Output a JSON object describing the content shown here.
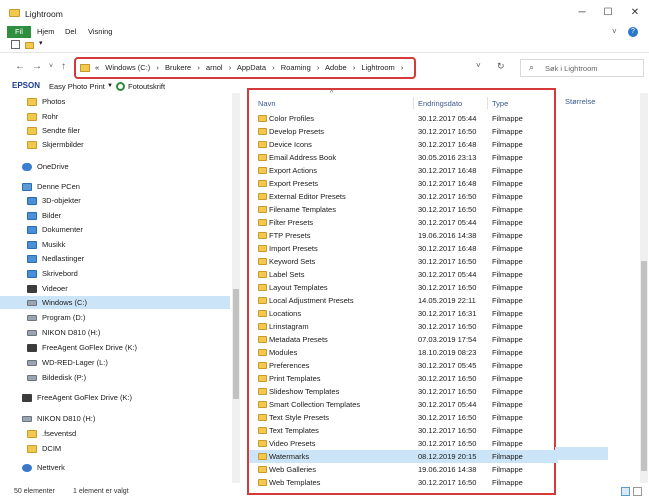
{
  "window": {
    "title": "Lightroom",
    "minimize": "─",
    "maximize": "☐",
    "close": "✕"
  },
  "ribbon": {
    "tabs": [
      "Fil",
      "Hjem",
      "Del",
      "Visning"
    ],
    "collapse": "˅",
    "help": "?"
  },
  "address": {
    "prefix": "«",
    "breadcrumb": [
      "Windows (C:)",
      "Brukere",
      "arnol",
      "AppData",
      "Roaming",
      "Adobe",
      "Lightroom"
    ],
    "separator": "›"
  },
  "search": {
    "placeholder": "Søk i Lightroom"
  },
  "epson_bar": {
    "logo": "EPSON",
    "app": "Easy Photo Print",
    "dropdown": "▼",
    "link": "Fotoutskrift"
  },
  "sidebar": {
    "items": [
      {
        "label": "Photos",
        "icon": "folder-icon"
      },
      {
        "label": "Rohr",
        "icon": "folder-icon"
      },
      {
        "label": "Sendte filer",
        "icon": "folder-icon"
      },
      {
        "label": "Skjermbilder",
        "icon": "folder-icon"
      },
      {
        "label": "OneDrive",
        "icon": "cloud-icon"
      },
      {
        "label": "Denne PCen",
        "icon": "computer-icon"
      },
      {
        "label": "3D-objekter",
        "icon": "cube-icon"
      },
      {
        "label": "Bilder",
        "icon": "pictures-icon"
      },
      {
        "label": "Dokumenter",
        "icon": "documents-icon"
      },
      {
        "label": "Musikk",
        "icon": "music-icon"
      },
      {
        "label": "Nedlastinger",
        "icon": "download-icon"
      },
      {
        "label": "Skrivebord",
        "icon": "desktop-icon"
      },
      {
        "label": "Videoer",
        "icon": "video-icon"
      },
      {
        "label": "Windows (C:)",
        "icon": "drive-icon"
      },
      {
        "label": "Program (D:)",
        "icon": "drive-icon"
      },
      {
        "label": "NIKON D810 (H:)",
        "icon": "sd-card-icon"
      },
      {
        "label": "FreeAgent GoFlex Drive (K:)",
        "icon": "external-drive-icon"
      },
      {
        "label": "WD-RED-Lager (L:)",
        "icon": "drive-icon"
      },
      {
        "label": "Bildedisk (P:)",
        "icon": "drive-icon"
      },
      {
        "label": "FreeAgent GoFlex Drive (K:)",
        "icon": "external-drive-icon"
      },
      {
        "label": "NIKON D810 (H:)",
        "icon": "sd-card-icon"
      },
      {
        "label": ".fseventsd",
        "icon": "folder-icon"
      },
      {
        "label": "DCIM",
        "icon": "folder-icon"
      },
      {
        "label": "Nettverk",
        "icon": "network-icon"
      }
    ]
  },
  "columns": {
    "name": "Navn",
    "date": "Endringsdato",
    "type": "Type",
    "size": "Størrelse",
    "sort_indicator": "^"
  },
  "files": [
    {
      "name": "Color Profiles",
      "date": "30.12.2017 05:44",
      "type": "Filmappe"
    },
    {
      "name": "Develop Presets",
      "date": "30.12.2017 16:50",
      "type": "Filmappe"
    },
    {
      "name": "Device Icons",
      "date": "30.12.2017 16:48",
      "type": "Filmappe"
    },
    {
      "name": "Email Address Book",
      "date": "30.05.2016 23:13",
      "type": "Filmappe"
    },
    {
      "name": "Export Actions",
      "date": "30.12.2017 16:48",
      "type": "Filmappe"
    },
    {
      "name": "Export Presets",
      "date": "30.12.2017 16:48",
      "type": "Filmappe"
    },
    {
      "name": "External Editor Presets",
      "date": "30.12.2017 16:50",
      "type": "Filmappe"
    },
    {
      "name": "Filename Templates",
      "date": "30.12.2017 16:50",
      "type": "Filmappe"
    },
    {
      "name": "Filter Presets",
      "date": "30.12.2017 05:44",
      "type": "Filmappe"
    },
    {
      "name": "FTP Presets",
      "date": "19.06.2016 14:38",
      "type": "Filmappe"
    },
    {
      "name": "Import Presets",
      "date": "30.12.2017 16:48",
      "type": "Filmappe"
    },
    {
      "name": "Keyword Sets",
      "date": "30.12.2017 16:50",
      "type": "Filmappe"
    },
    {
      "name": "Label Sets",
      "date": "30.12.2017 05:44",
      "type": "Filmappe"
    },
    {
      "name": "Layout Templates",
      "date": "30.12.2017 16:50",
      "type": "Filmappe"
    },
    {
      "name": "Local Adjustment Presets",
      "date": "14.05.2019 22:11",
      "type": "Filmappe"
    },
    {
      "name": "Locations",
      "date": "30.12.2017 16:31",
      "type": "Filmappe"
    },
    {
      "name": "Lrinstagram",
      "date": "30.12.2017 16:50",
      "type": "Filmappe"
    },
    {
      "name": "Metadata Presets",
      "date": "07.03.2019 17:54",
      "type": "Filmappe"
    },
    {
      "name": "Modules",
      "date": "18.10.2019 08:23",
      "type": "Filmappe"
    },
    {
      "name": "Preferences",
      "date": "30.12.2017 05:45",
      "type": "Filmappe"
    },
    {
      "name": "Print Templates",
      "date": "30.12.2017 16:50",
      "type": "Filmappe"
    },
    {
      "name": "Slideshow Templates",
      "date": "30.12.2017 16:50",
      "type": "Filmappe"
    },
    {
      "name": "Smart Collection Templates",
      "date": "30.12.2017 05:44",
      "type": "Filmappe"
    },
    {
      "name": "Text Style Presets",
      "date": "30.12.2017 16:50",
      "type": "Filmappe"
    },
    {
      "name": "Text Templates",
      "date": "30.12.2017 16:50",
      "type": "Filmappe"
    },
    {
      "name": "Video Presets",
      "date": "30.12.2017 16:50",
      "type": "Filmappe"
    },
    {
      "name": "Watermarks",
      "date": "08.12.2019 20:15",
      "type": "Filmappe",
      "selected": true
    },
    {
      "name": "Web Galleries",
      "date": "19.06.2016 14:38",
      "type": "Filmappe"
    },
    {
      "name": "Web Templates",
      "date": "30.12.2017 16:50",
      "type": "Filmappe"
    }
  ],
  "status": {
    "items": "50 elementer",
    "selected": "1 element er valgt"
  },
  "colors": {
    "accent": "#2f8f3f",
    "highlight": "#d43a3a",
    "selection": "#cce4f7"
  }
}
